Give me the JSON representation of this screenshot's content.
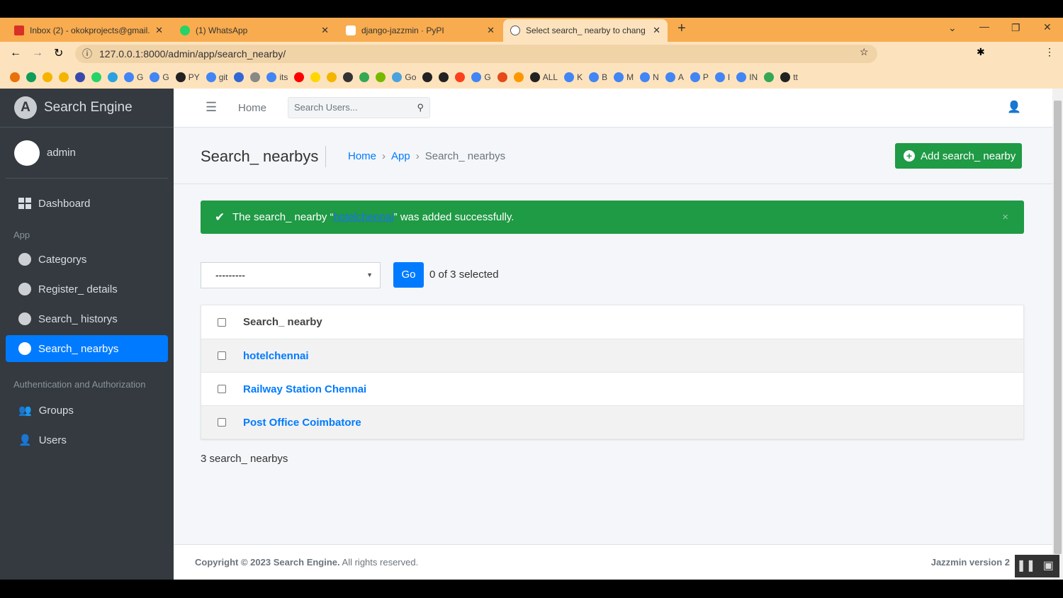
{
  "browser": {
    "tabs": [
      {
        "title": "Inbox (2) - okokprojects@gmail.c",
        "icon": "gmail-icon",
        "color": "#d93025"
      },
      {
        "title": "(1) WhatsApp",
        "icon": "whatsapp-icon",
        "color": "#25d366"
      },
      {
        "title": "django-jazzmin · PyPI",
        "icon": "pypi-icon",
        "color": "#ffffff"
      },
      {
        "title": "Select search_ nearby to change",
        "icon": "jazzmin-icon",
        "color": "#ffffff"
      }
    ],
    "url": "127.0.0.1:8000/admin/app/search_nearby/",
    "bookmarks": [
      "",
      "",
      "",
      "",
      "",
      "",
      "",
      "G",
      "G",
      "PY",
      "git",
      "",
      "",
      "its",
      "",
      "",
      "",
      "",
      "",
      "",
      "Go",
      "",
      "",
      "",
      "G",
      "",
      "",
      "ALL",
      "K",
      "B",
      "M",
      "N",
      "A",
      "P",
      "I",
      "IN",
      "",
      "tt"
    ]
  },
  "sidebar": {
    "brand": "Search Engine",
    "brand_logo": "A",
    "user": "admin",
    "dashboard": "Dashboard",
    "section_app": "App",
    "app_items": [
      "Categorys",
      "Register_ details",
      "Search_ historys",
      "Search_ nearbys"
    ],
    "section_auth": "Authentication and Authorization",
    "auth_items": [
      "Groups",
      "Users"
    ]
  },
  "topnav": {
    "home": "Home",
    "search_placeholder": "Search Users..."
  },
  "page": {
    "title": "Search_ nearbys",
    "breadcrumb": [
      "Home",
      "App",
      "Search_ nearbys"
    ],
    "add_button": "Add search_ nearby",
    "alert": {
      "prefix": "The search_ nearby “",
      "link": "hotelchennai",
      "suffix": "” was added successfully."
    },
    "action_select": "---------",
    "go": "Go",
    "selected": "0 of 3 selected",
    "column": "Search_ nearby",
    "rows": [
      "hotelchennai",
      "Railway Station Chennai",
      "Post Office Coimbatore"
    ],
    "count": "3 search_ nearbys"
  },
  "footer": {
    "copyright": "Copyright © 2023 Search Engine.",
    "rights": "All rights reserved.",
    "version": "Jazzmin version 2"
  },
  "colors": {
    "sidebar": "#343a40",
    "primary": "#007bff",
    "success": "#1f9a45"
  }
}
